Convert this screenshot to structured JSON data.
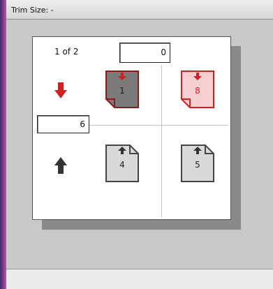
{
  "window": {
    "title": "Trim Size: -"
  },
  "imposition": {
    "page_count_label": "1 of 2",
    "top_field_value": "0",
    "left_field_value": "6",
    "pages": [
      {
        "number": "1",
        "state": "selected"
      },
      {
        "number": "8",
        "state": "highlighted"
      },
      {
        "number": "4",
        "state": "normal"
      },
      {
        "number": "5",
        "state": "normal"
      }
    ]
  },
  "colors": {
    "accent_red": "#d02020",
    "selected_fill": "#7a7a7a",
    "page_fill": "#d9d9d9"
  },
  "icons": {
    "down_arrow": "arrow-down-icon",
    "up_arrow": "arrow-up-icon"
  }
}
